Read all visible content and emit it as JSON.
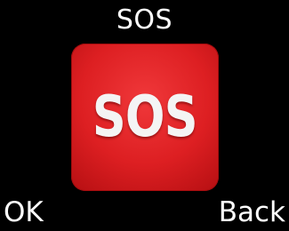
{
  "header": {
    "title": "SOS"
  },
  "icon": {
    "name": "sos-icon",
    "label": "SOS",
    "color": "#dd1f22"
  },
  "softkeys": {
    "left": "OK",
    "right": "Back"
  }
}
